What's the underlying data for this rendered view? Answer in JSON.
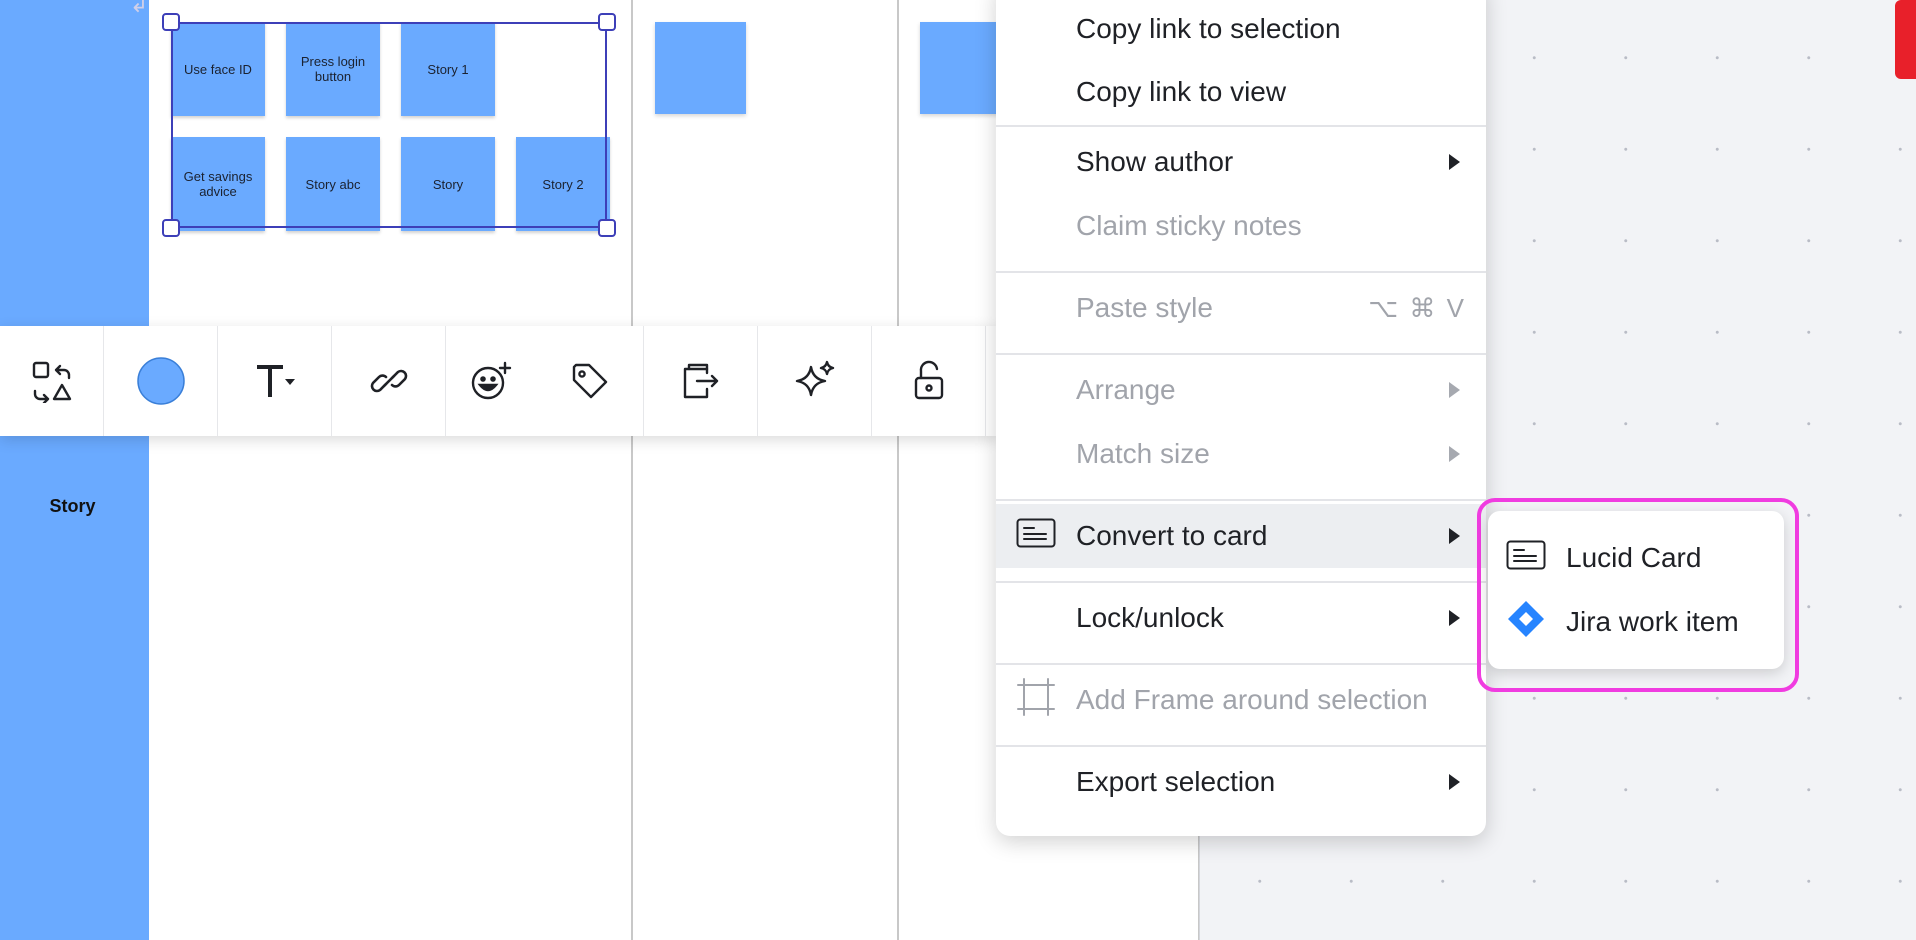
{
  "board": {
    "lane_label": "Story",
    "stickies": [
      {
        "text": "Use face ID"
      },
      {
        "text": "Press login button"
      },
      {
        "text": "Story 1"
      },
      {
        "text": "Get savings advice"
      },
      {
        "text": "Story abc"
      },
      {
        "text": "Story"
      },
      {
        "text": "Story 2"
      }
    ]
  },
  "toolbar": {
    "items": [
      {
        "name": "change-shape-icon"
      },
      {
        "name": "fill-color-icon",
        "color": "#6aaaff"
      },
      {
        "name": "text-style-icon"
      },
      {
        "name": "link-icon"
      },
      {
        "name": "reaction-icon"
      },
      {
        "name": "tag-icon"
      },
      {
        "name": "export-icon"
      },
      {
        "name": "ai-sparkle-icon"
      },
      {
        "name": "lock-icon"
      }
    ]
  },
  "context_menu": {
    "copy_link_selection": "Copy link to selection",
    "copy_link_view": "Copy link to view",
    "show_author": "Show author",
    "claim_sticky_notes": "Claim sticky notes",
    "paste_style": "Paste style",
    "paste_style_shortcut": "⌥ ⌘ V",
    "arrange": "Arrange",
    "match_size": "Match size",
    "convert_to_card": "Convert to card",
    "lock_unlock": "Lock/unlock",
    "add_frame": "Add Frame around selection",
    "export_selection": "Export selection"
  },
  "submenu": {
    "lucid_card": "Lucid Card",
    "jira_work_item": "Jira work item"
  },
  "colors": {
    "sticky": "#6aaaff",
    "selection": "#3d3fb8",
    "highlight": "#f03ce0",
    "jira": "#2684ff"
  }
}
